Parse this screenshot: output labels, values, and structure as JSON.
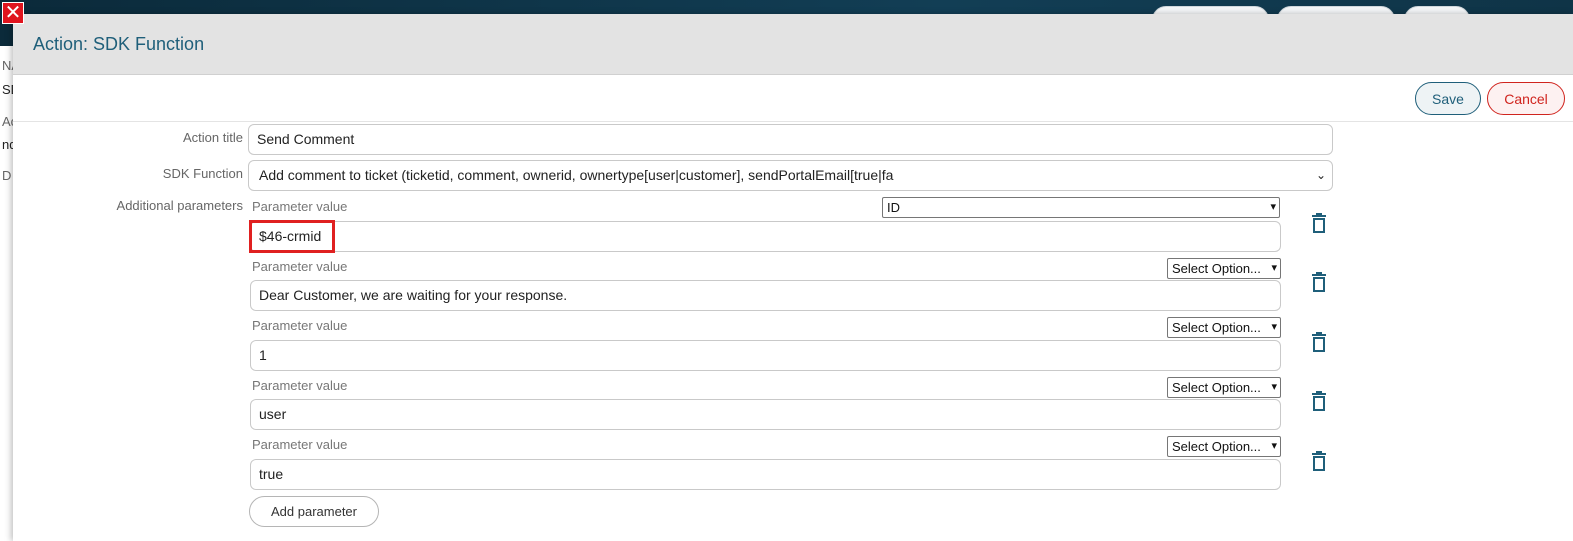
{
  "window": {
    "close_glyph": "✕"
  },
  "background": {
    "left_fragments": [
      "NA",
      "SD",
      "Ac",
      "nd",
      "D"
    ]
  },
  "modal": {
    "title": "Action: SDK Function",
    "toolbar": {
      "save_label": "Save",
      "cancel_label": "Cancel"
    },
    "form": {
      "action_title": {
        "label": "Action title",
        "value": "Send Comment"
      },
      "sdk_function": {
        "label": "SDK Function",
        "selected": "Add comment to ticket (ticketid, comment, ownerid, ownertype[user|customer], sendPortalEmail[true|fa"
      },
      "additional_parameters": {
        "label": "Additional parameters",
        "params": [
          {
            "label": "Parameter value",
            "option": "ID",
            "value": "$46-crmid"
          },
          {
            "label": "Parameter value",
            "option": "Select Option...",
            "value": "Dear Customer, we are waiting for your response."
          },
          {
            "label": "Parameter value",
            "option": "Select Option...",
            "value": "1"
          },
          {
            "label": "Parameter value",
            "option": "Select Option...",
            "value": "user"
          },
          {
            "label": "Parameter value",
            "option": "Select Option...",
            "value": "true"
          }
        ],
        "add_label": "Add parameter"
      }
    }
  },
  "icons": {
    "close": "close-icon",
    "delete": "trash-icon",
    "dropdown": "chevron-down-icon"
  },
  "colors": {
    "accent": "#1f5f7a",
    "danger": "#d0241e",
    "highlight": "#e02020"
  }
}
